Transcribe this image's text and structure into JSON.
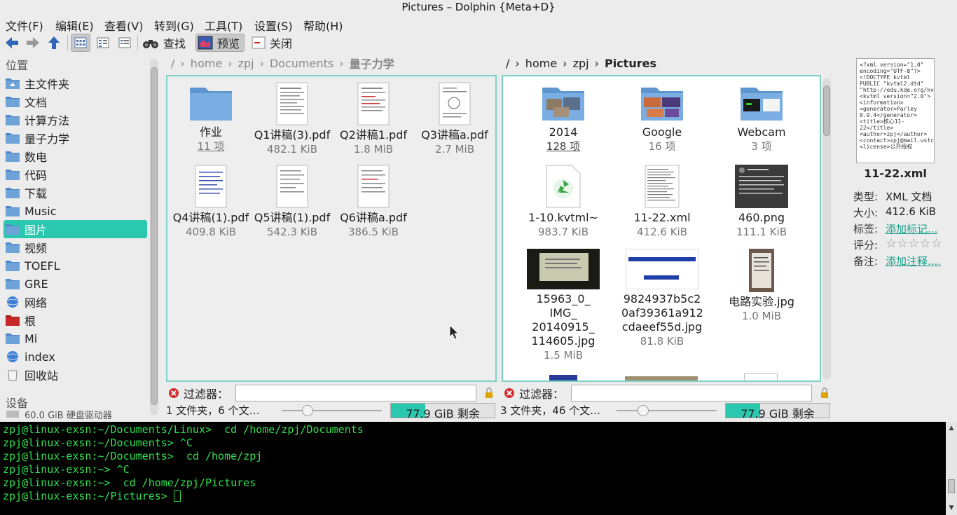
{
  "window": {
    "title": "Pictures – Dolphin {Meta+D}"
  },
  "menu": [
    "文件(F)",
    "编辑(E)",
    "查看(V)",
    "转到(G)",
    "工具(T)",
    "设置(S)",
    "帮助(H)"
  ],
  "toolbar": {
    "find_label": "查找",
    "preview_label": "预览",
    "close_label": "关闭"
  },
  "places": {
    "title": "位置",
    "items": [
      "主文件夹",
      "文档",
      "计算方法",
      "量子力学",
      "数电",
      "代码",
      "下载",
      "Music",
      "图片",
      "视频",
      "TOEFL",
      "GRE",
      "网络",
      "根",
      "Mi",
      "index",
      "回收站"
    ],
    "selected": "图片",
    "devices_title": "设备",
    "device_partial": "60.0 GiB 硬盘驱动器"
  },
  "left_panel": {
    "breadcrumb": [
      "/",
      "home",
      "zpj",
      "Documents",
      "量子力学"
    ],
    "items": [
      {
        "name": "作业",
        "sub": "11 项"
      },
      {
        "name": "Q1讲稿(3).pdf",
        "sub": "482.1 KiB"
      },
      {
        "name": "Q2讲稿1.pdf",
        "sub": "1.8 MiB"
      },
      {
        "name": "Q3讲稿a.pdf",
        "sub": "2.7 MiB"
      },
      {
        "name": "Q4讲稿(1).pdf",
        "sub": "409.8 KiB"
      },
      {
        "name": "Q5讲稿(1).pdf",
        "sub": "542.3 KiB"
      },
      {
        "name": "Q6讲稿a.pdf",
        "sub": "386.5 KiB"
      }
    ],
    "filter_label": "过滤器：",
    "status": "1 文件夹，6 个文…",
    "free_space": "77.9 GiB 剩余"
  },
  "right_panel": {
    "breadcrumb": [
      "/",
      "home",
      "zpj",
      "Pictures"
    ],
    "items": [
      {
        "name": "2014",
        "sub": "128 项"
      },
      {
        "name": "Google",
        "sub": "16 项"
      },
      {
        "name": "Webcam",
        "sub": "3 项"
      },
      {
        "name": "1-10.kvtml~",
        "sub": "983.7 KiB"
      },
      {
        "name": "11-22.xml",
        "sub": "412.6 KiB"
      },
      {
        "name": "460.png",
        "sub": "111.1 KiB"
      },
      {
        "name": "15963_0_IMG_20140915_114605.jpg",
        "name_lines": [
          "15963_0_",
          "IMG_",
          "20140915_",
          "114605.jpg"
        ],
        "sub": "1.5 MiB"
      },
      {
        "name": "9824937b5c20af39361a912cdaeef55d.jpg",
        "name_lines": [
          "9824937b5c2",
          "0af39361a912",
          "cdaeef55d.jpg"
        ],
        "sub": "81.8 KiB"
      },
      {
        "name": "电路实验.jpg",
        "sub": "1.0 MiB"
      }
    ],
    "filter_label": "过滤器：",
    "status": "3 文件夹，46 个文…",
    "free_space": "77.9 GiB 剩余",
    "free_fraction": 0.33
  },
  "info_panel": {
    "preview_text": "<?xml version=\"1.0\" encoding=\"UTF-8\"?> <!DOCTYPE kvtml PUBLIC \"kvtml2.dtd\" \"http://edu.kde.org/kvtml/kvtml2.dtd\"> <kvtml version=\"2.0\"> <information> <generator>Parley 0.9.4</generator> <title>核心11-22</title> <author>zpj</author> <contact>zpj@mail.ustc.edu.cn</contact> <license>公开授权",
    "filename": "11-22.xml",
    "type_label": "类型:",
    "type_value": "XML 文档",
    "size_label": "大小:",
    "size_value": "412.6 KiB",
    "tags_label": "标签:",
    "tags_value": "添加标记...",
    "rating_label": "评分:",
    "rating": 0,
    "comment_label": "备注:",
    "comment_value": "添加注释...."
  },
  "terminal": {
    "lines": [
      "zpj@linux-exsn:~/Documents/Linux>  cd /home/zpj/Documents",
      "zpj@linux-exsn:~/Documents> ^C",
      "zpj@linux-exsn:~/Documents>  cd /home/zpj",
      "zpj@linux-exsn:~> ^C",
      "zpj@linux-exsn:~>  cd /home/zpj/Pictures",
      "zpj@linux-exsn:~/Pictures> "
    ]
  },
  "colors": {
    "accent": "#2bc8b0",
    "folder": "#6ea3d8",
    "terminal_text": "#2fe04e"
  }
}
